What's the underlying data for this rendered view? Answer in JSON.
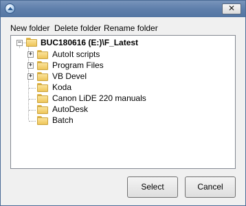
{
  "titlebar": {
    "close_glyph": "✕"
  },
  "menu": [
    "New folder",
    "Delete folder",
    "Rename folder"
  ],
  "tree": {
    "root": "BUC180616 (E:)\\F_Latest",
    "children": [
      "AutoIt scripts",
      "Program Files",
      "VB Devel",
      "Koda",
      "Canon LiDE 220 manuals",
      "AutoDesk",
      "Batch"
    ],
    "expandable": [
      true,
      true,
      true,
      false,
      false,
      false,
      false
    ]
  },
  "buttons": {
    "select": "Select",
    "cancel": "Cancel"
  }
}
